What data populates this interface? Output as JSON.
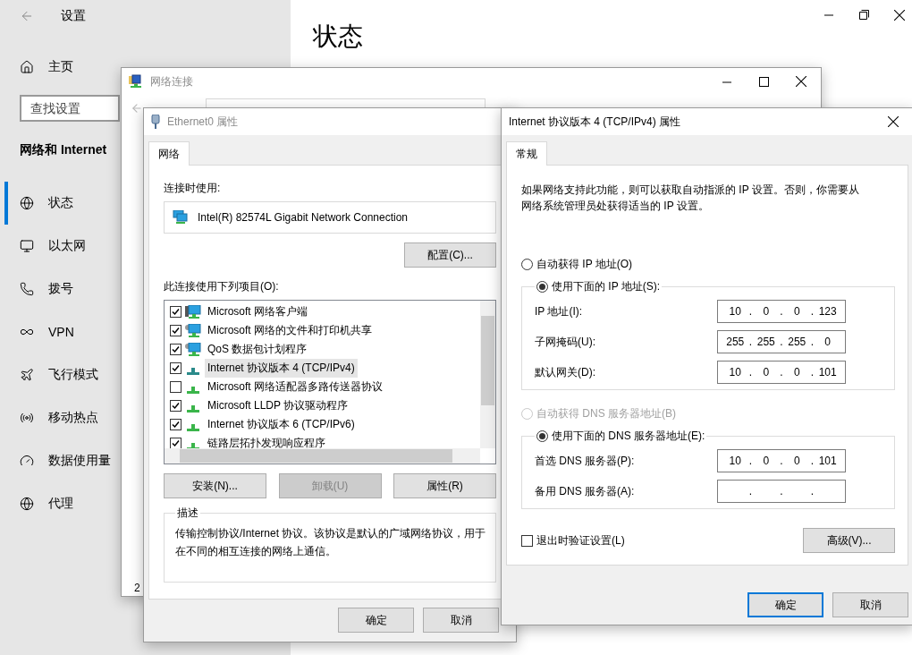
{
  "settings": {
    "title": "设置",
    "home": "主页",
    "search": {
      "placeholder": "查找设置"
    },
    "section": "网络和 Internet",
    "page_title": "状态",
    "nav": [
      {
        "label": "状态",
        "kind": "status",
        "selected": true
      },
      {
        "label": "以太网",
        "kind": "ethernet",
        "selected": false
      },
      {
        "label": "拨号",
        "kind": "dialup",
        "selected": false
      },
      {
        "label": "VPN",
        "kind": "vpn",
        "selected": false
      },
      {
        "label": "飞行模式",
        "kind": "airplane",
        "selected": false
      },
      {
        "label": "移动热点",
        "kind": "hotspot",
        "selected": false
      },
      {
        "label": "数据使用量",
        "kind": "data",
        "selected": false
      },
      {
        "label": "代理",
        "kind": "proxy",
        "selected": false
      }
    ]
  },
  "network_window": {
    "title": "网络连接",
    "status_text": "2"
  },
  "ethernet_dialog": {
    "title": "Ethernet0 属性",
    "tabs": [
      {
        "label": "网络",
        "selected": true
      }
    ],
    "connect_using_label": "连接时使用:",
    "adapter": "Intel(R) 82574L Gigabit Network Connection",
    "configure_button": "配置(C)...",
    "items_label": "此连接使用下列项目(O):",
    "items": [
      {
        "label": "Microsoft 网络客户端",
        "kind": "client",
        "checked": true,
        "selected": false
      },
      {
        "label": "Microsoft 网络的文件和打印机共享",
        "kind": "service",
        "checked": true,
        "selected": false
      },
      {
        "label": "QoS 数据包计划程序",
        "kind": "service",
        "checked": true,
        "selected": false
      },
      {
        "label": "Internet 协议版本 4 (TCP/IPv4)",
        "kind": "protocol",
        "checked": true,
        "selected": true
      },
      {
        "label": "Microsoft 网络适配器多路传送器协议",
        "kind": "protocol",
        "checked": false,
        "selected": false
      },
      {
        "label": "Microsoft LLDP 协议驱动程序",
        "kind": "protocol",
        "checked": true,
        "selected": false
      },
      {
        "label": "Internet 协议版本 6 (TCP/IPv6)",
        "kind": "protocol",
        "checked": true,
        "selected": false
      },
      {
        "label": "链路层拓扑发现响应程序",
        "kind": "protocol",
        "checked": true,
        "selected": false
      }
    ],
    "buttons": [
      {
        "label": "安装(N)...",
        "disabled": false
      },
      {
        "label": "卸载(U)",
        "disabled": true
      },
      {
        "label": "属性(R)",
        "disabled": false
      }
    ],
    "description_title": "描述",
    "description": "传输控制协议/Internet 协议。该协议是默认的广域网络协议，用于在不同的相互连接的网络上通信。",
    "footer_buttons": [
      {
        "label": "确定",
        "focused": false
      },
      {
        "label": "取消",
        "focused": false
      }
    ]
  },
  "ipv4_dialog": {
    "title": "Internet 协议版本 4 (TCP/IPv4) 属性",
    "tabs": [
      {
        "label": "常规",
        "selected": true
      }
    ],
    "intro": "如果网络支持此功能，则可以获取自动指派的 IP 设置。否则，你需要从网络系统管理员处获得适当的 IP 设置。",
    "separator": ".",
    "ip_options": [
      {
        "label": "自动获得 IP 地址(O)",
        "selected": false,
        "disabled": false
      },
      {
        "label": "使用下面的 IP 地址(S):",
        "selected": true,
        "disabled": false
      }
    ],
    "ip_fields": [
      {
        "label": "IP 地址(I):",
        "octets": [
          "10",
          "0",
          "0",
          "123"
        ]
      },
      {
        "label": "子网掩码(U):",
        "octets": [
          "255",
          "255",
          "255",
          "0"
        ]
      },
      {
        "label": "默认网关(D):",
        "octets": [
          "10",
          "0",
          "0",
          "101"
        ]
      }
    ],
    "dns_options": [
      {
        "label": "自动获得 DNS 服务器地址(B)",
        "selected": false,
        "disabled": true
      },
      {
        "label": "使用下面的 DNS 服务器地址(E):",
        "selected": true,
        "disabled": false
      }
    ],
    "dns_fields": [
      {
        "label": "首选 DNS 服务器(P):",
        "octets": [
          "10",
          "0",
          "0",
          "101"
        ]
      },
      {
        "label": "备用 DNS 服务器(A):"
      }
    ],
    "validate": {
      "label": "退出时验证设置(L)",
      "checked": false
    },
    "advanced_button": "高级(V)...",
    "footer_buttons": [
      {
        "label": "确定",
        "focused": true
      },
      {
        "label": "取消",
        "focused": false
      }
    ]
  }
}
